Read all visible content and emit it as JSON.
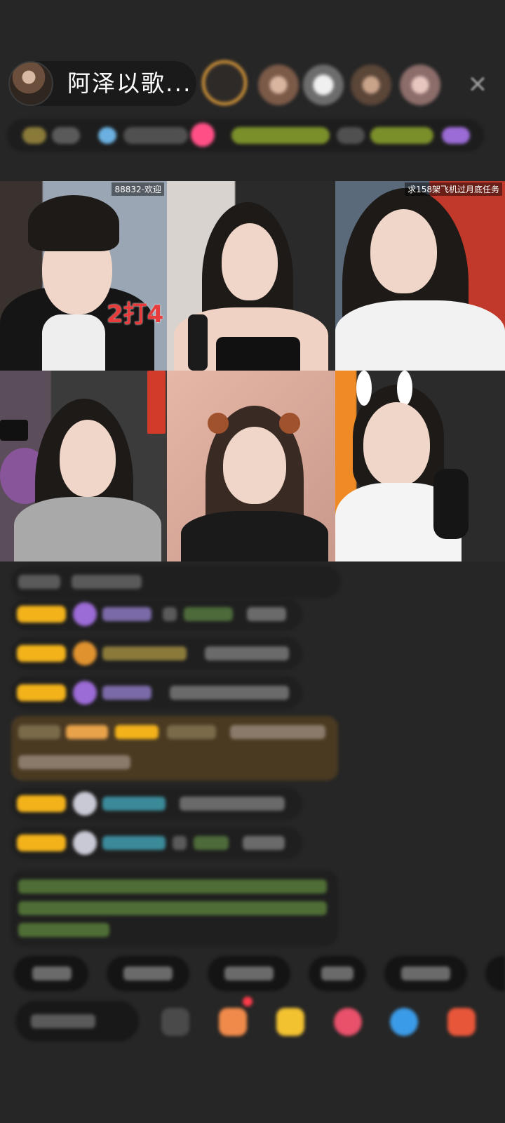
{
  "header": {
    "host_name": "阿泽以歌...",
    "close_icon": "close-icon"
  },
  "video_grid": {
    "tiles": [
      {
        "caption": "88832-欢迎",
        "overlay": "2打4"
      },
      {
        "caption": "",
        "overlay": ""
      },
      {
        "caption": "求158架飞机过月底任务",
        "overlay": ""
      },
      {
        "caption": "",
        "overlay": ""
      },
      {
        "caption": "",
        "overlay": ""
      },
      {
        "caption": "",
        "overlay": ""
      }
    ]
  },
  "colors": {
    "background": "#262626",
    "badge": "#f3b21a",
    "accent_green": "#7fc24a",
    "accent_cyan": "#3aa6b8",
    "accent_purple": "#9b6bd6",
    "overlay_red": "#e83b3b"
  }
}
